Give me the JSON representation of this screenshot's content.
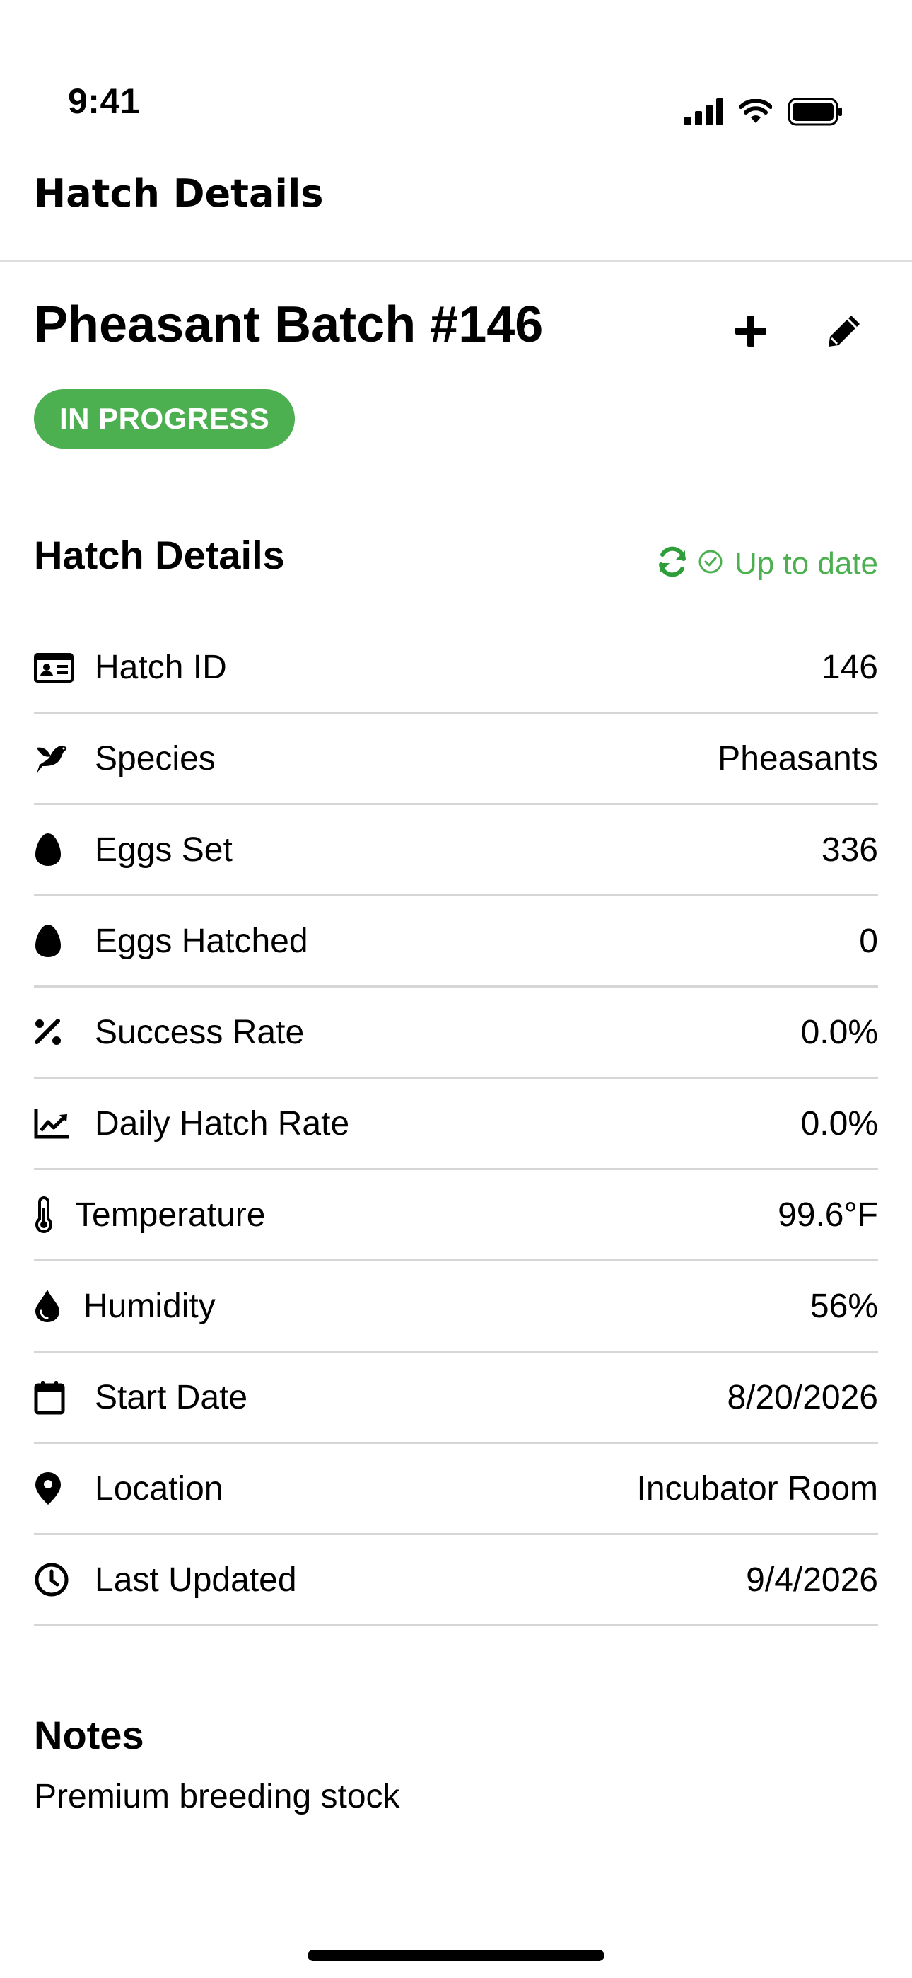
{
  "status_bar": {
    "time": "9:41",
    "icons": [
      "cellular-signal-icon",
      "wifi-icon",
      "battery-icon"
    ]
  },
  "header": {
    "title": "Hatch Details"
  },
  "batch": {
    "title": "Pheasant Batch #146",
    "status": "IN PROGRESS",
    "actions": {
      "add_icon": "plus-icon",
      "edit_icon": "pencil-icon"
    }
  },
  "details_section": {
    "title": "Hatch Details",
    "sync_status": "Up to date",
    "rows": [
      {
        "icon": "id-card-icon",
        "label": "Hatch ID",
        "value": "146"
      },
      {
        "icon": "bird-icon",
        "label": "Species",
        "value": "Pheasants"
      },
      {
        "icon": "egg-icon",
        "label": "Eggs Set",
        "value": "336"
      },
      {
        "icon": "egg-icon",
        "label": "Eggs Hatched",
        "value": "0"
      },
      {
        "icon": "percent-icon",
        "label": "Success Rate",
        "value": "0.0%"
      },
      {
        "icon": "chart-line-icon",
        "label": "Daily Hatch Rate",
        "value": "0.0%"
      },
      {
        "icon": "thermometer-icon",
        "label": "Temperature",
        "value": "99.6°F"
      },
      {
        "icon": "droplet-icon",
        "label": "Humidity",
        "value": "56%"
      },
      {
        "icon": "calendar-icon",
        "label": "Start Date",
        "value": "8/20/2026"
      },
      {
        "icon": "map-pin-icon",
        "label": "Location",
        "value": "Incubator Room"
      },
      {
        "icon": "clock-icon",
        "label": "Last Updated",
        "value": "9/4/2026"
      }
    ]
  },
  "notes": {
    "title": "Notes",
    "text": "Premium breeding stock"
  },
  "colors": {
    "accent_green": "#4caf50",
    "sync_icon_green": "#2e9e3a",
    "divider": "#d6d6d6"
  }
}
